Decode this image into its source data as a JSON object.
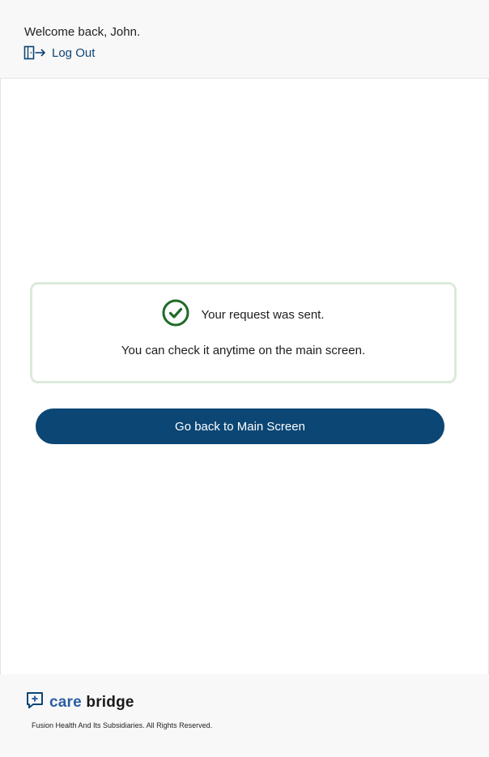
{
  "header": {
    "welcome_text": "Welcome back, John.",
    "logout_label": "Log Out",
    "logout_icon": "door-exit-icon"
  },
  "confirmation": {
    "icon": "check-circle-icon",
    "title": "Your request was sent.",
    "message": "You can check it anytime on the main screen."
  },
  "actions": {
    "back_label": "Go back to Main Screen"
  },
  "footer": {
    "brand_icon": "chat-plus-icon",
    "brand_part1": "care",
    "brand_part2": "bridge",
    "copyright": "Fusion Health And Its Subsidiaries. All Rights Reserved."
  },
  "colors": {
    "primary": "#0b4674",
    "success": "#1f6b28",
    "notice_border": "#dbeadb",
    "brand_care": "#2c5fa3"
  }
}
